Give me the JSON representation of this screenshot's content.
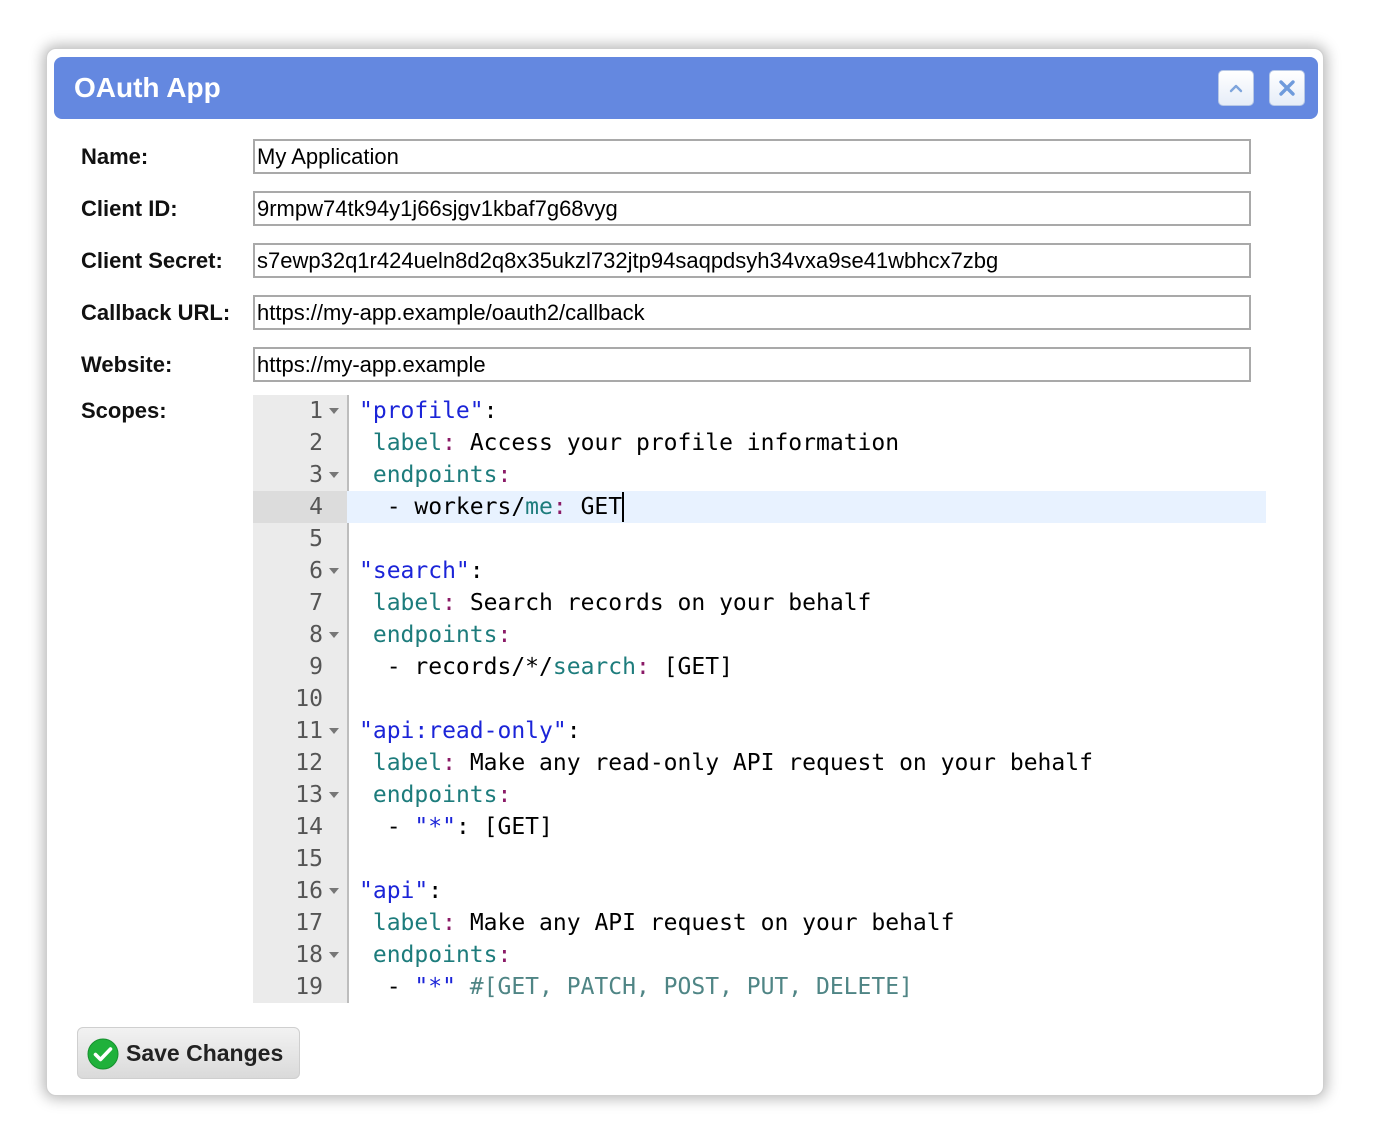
{
  "window": {
    "title": "OAuth App"
  },
  "form": {
    "name_label": "Name:",
    "name_value": "My Application",
    "client_id_label": "Client ID:",
    "client_id_value": "9rmpw74tk94y1j66sjgv1kbaf7g68vyg",
    "client_secret_label": "Client Secret:",
    "client_secret_value": "s7ewp32q1r424ueln8d2q8x35ukzl732jtp94saqpdsyh34vxa9se41wbhcx7zbg",
    "callback_label": "Callback URL:",
    "callback_value": "https://my-app.example/oauth2/callback",
    "website_label": "Website:",
    "website_value": "https://my-app.example",
    "scopes_label": "Scopes:"
  },
  "editor": {
    "active_line": 4,
    "lines": [
      {
        "n": "1",
        "fold": true,
        "tokens": [
          [
            "str",
            "\"profile\""
          ],
          [
            "txt",
            ":"
          ]
        ]
      },
      {
        "n": "2",
        "fold": false,
        "tokens": [
          [
            "txt",
            " "
          ],
          [
            "key",
            "label"
          ],
          [
            "sep",
            ":"
          ],
          [
            "txt",
            " Access your profile information"
          ]
        ]
      },
      {
        "n": "3",
        "fold": true,
        "tokens": [
          [
            "txt",
            " "
          ],
          [
            "key",
            "endpoints"
          ],
          [
            "sep",
            ":"
          ]
        ]
      },
      {
        "n": "4",
        "fold": false,
        "cursor": true,
        "tokens": [
          [
            "txt",
            "  - workers/"
          ],
          [
            "key",
            "me"
          ],
          [
            "sep",
            ":"
          ],
          [
            "txt",
            " GET"
          ]
        ]
      },
      {
        "n": "5",
        "fold": false,
        "tokens": []
      },
      {
        "n": "6",
        "fold": true,
        "tokens": [
          [
            "str",
            "\"search\""
          ],
          [
            "txt",
            ":"
          ]
        ]
      },
      {
        "n": "7",
        "fold": false,
        "tokens": [
          [
            "txt",
            " "
          ],
          [
            "key",
            "label"
          ],
          [
            "sep",
            ":"
          ],
          [
            "txt",
            " Search records on your behalf"
          ]
        ]
      },
      {
        "n": "8",
        "fold": true,
        "tokens": [
          [
            "txt",
            " "
          ],
          [
            "key",
            "endpoints"
          ],
          [
            "sep",
            ":"
          ]
        ]
      },
      {
        "n": "9",
        "fold": false,
        "tokens": [
          [
            "txt",
            "  - records/*/"
          ],
          [
            "key",
            "search"
          ],
          [
            "sep",
            ":"
          ],
          [
            "txt",
            " [GET]"
          ]
        ]
      },
      {
        "n": "10",
        "fold": false,
        "tokens": []
      },
      {
        "n": "11",
        "fold": true,
        "tokens": [
          [
            "str",
            "\"api:read-only\""
          ],
          [
            "txt",
            ":"
          ]
        ]
      },
      {
        "n": "12",
        "fold": false,
        "tokens": [
          [
            "txt",
            " "
          ],
          [
            "key",
            "label"
          ],
          [
            "sep",
            ":"
          ],
          [
            "txt",
            " Make any read-only API request on your behalf"
          ]
        ]
      },
      {
        "n": "13",
        "fold": true,
        "tokens": [
          [
            "txt",
            " "
          ],
          [
            "key",
            "endpoints"
          ],
          [
            "sep",
            ":"
          ]
        ]
      },
      {
        "n": "14",
        "fold": false,
        "tokens": [
          [
            "txt",
            "  - "
          ],
          [
            "str",
            "\"*\""
          ],
          [
            "txt",
            ": [GET]"
          ]
        ]
      },
      {
        "n": "15",
        "fold": false,
        "tokens": []
      },
      {
        "n": "16",
        "fold": true,
        "tokens": [
          [
            "str",
            "\"api\""
          ],
          [
            "txt",
            ":"
          ]
        ]
      },
      {
        "n": "17",
        "fold": false,
        "tokens": [
          [
            "txt",
            " "
          ],
          [
            "key",
            "label"
          ],
          [
            "sep",
            ":"
          ],
          [
            "txt",
            " Make any API request on your behalf"
          ]
        ]
      },
      {
        "n": "18",
        "fold": true,
        "tokens": [
          [
            "txt",
            " "
          ],
          [
            "key",
            "endpoints"
          ],
          [
            "sep",
            ":"
          ]
        ]
      },
      {
        "n": "19",
        "fold": false,
        "tokens": [
          [
            "txt",
            "  - "
          ],
          [
            "str",
            "\"*\""
          ],
          [
            "txt",
            " "
          ],
          [
            "cmt",
            "#[GET, PATCH, POST, PUT, DELETE]"
          ]
        ]
      }
    ]
  },
  "actions": {
    "save_label": "Save Changes",
    "save_icon": "checkmark-circle-icon",
    "collapse_icon": "chevron-up-icon",
    "close_icon": "close-icon"
  },
  "colors": {
    "titlebar": "#6488e0",
    "string": "#1b24d8",
    "key": "#1d7c7c",
    "separator": "#8a1a66",
    "comment": "#4f8585",
    "active_line": "#e8f2ff",
    "save_check": "#1fb13b"
  }
}
